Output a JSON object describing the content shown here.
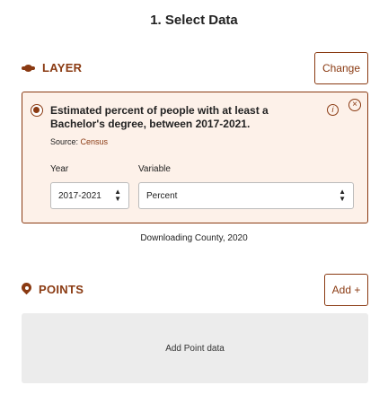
{
  "header": {
    "title": "1. Select Data"
  },
  "layer": {
    "section_label": "LAYER",
    "change_label": "Change",
    "description": "Estimated percent of people with at least a Bachelor's degree, between 2017-2021.",
    "source_prefix": "Source: ",
    "source_link": "Census",
    "info_glyph": "i",
    "close_glyph": "×",
    "year_label": "Year",
    "variable_label": "Variable",
    "year_value": "2017-2021",
    "variable_value": "Percent",
    "status": "Downloading County, 2020"
  },
  "points": {
    "section_label": "POINTS",
    "add_label": "Add +",
    "empty_label": "Add Point data"
  },
  "colors": {
    "accent": "#8a3a12",
    "card_bg": "#fdf1e9",
    "empty_bg": "#ececec"
  }
}
